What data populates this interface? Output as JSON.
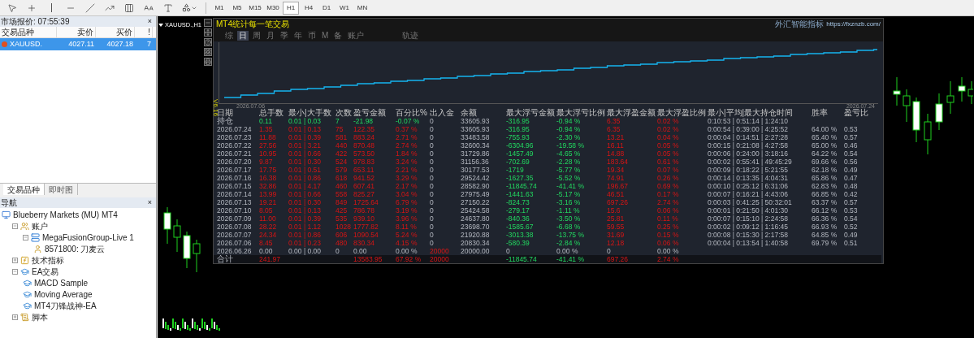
{
  "toolbar": {
    "timeframes": [
      {
        "label": "M1",
        "selected": false
      },
      {
        "label": "M5",
        "selected": false
      },
      {
        "label": "M15",
        "selected": false
      },
      {
        "label": "M30",
        "selected": false
      },
      {
        "label": "H1",
        "selected": true
      },
      {
        "label": "H4",
        "selected": false
      },
      {
        "label": "D1",
        "selected": false
      },
      {
        "label": "W1",
        "selected": false
      },
      {
        "label": "MN",
        "selected": false
      }
    ]
  },
  "market_watch": {
    "title": "市场报价: 07:55:39",
    "close": "×",
    "columns": [
      "交易品种",
      "卖价",
      "买价",
      "!"
    ],
    "rows": [
      {
        "cells": [
          "XAUUSD.",
          "4027.11",
          "4027.18",
          "7"
        ],
        "selected": true
      }
    ],
    "tabs": [
      {
        "label": "交易品种",
        "selected": true
      },
      {
        "label": "即时图",
        "selected": false
      }
    ]
  },
  "navigator": {
    "title": "导航",
    "close": "×",
    "tree": [
      {
        "label": "Blueberry Markets (MU) MT4",
        "kind": "terminal",
        "children": [
          {
            "label": "账户",
            "kind": "accounts",
            "expanded": true,
            "children": [
              {
                "label": "MegaFusionGroup-Live 1",
                "kind": "server",
                "expanded": true,
                "children": [
                  {
                    "label": "8571800: 刀麦云",
                    "kind": "account"
                  }
                ]
              }
            ]
          },
          {
            "label": "技术指标",
            "kind": "indicators",
            "expanded": false
          },
          {
            "label": "EA交易",
            "kind": "experts",
            "expanded": true,
            "children": [
              {
                "label": "MACD Sample",
                "kind": "expert"
              },
              {
                "label": "Moving Average",
                "kind": "expert"
              },
              {
                "label": "MT4刀锋战神-EA",
                "kind": "expert"
              }
            ]
          },
          {
            "label": "脚本",
            "kind": "scripts",
            "expanded": false
          }
        ]
      }
    ]
  },
  "chart": {
    "title": "XAUUSD.,H1",
    "panel": {
      "title": "MT4统计每一笔交易",
      "brand": "外汇智能指标",
      "link": "https://fxznzb.com/",
      "version": "V6.16",
      "tabs": [
        {
          "label": "综",
          "selected": false
        },
        {
          "label": "日",
          "selected": true
        },
        {
          "label": "周",
          "selected": false
        },
        {
          "label": "月",
          "selected": false
        },
        {
          "label": "季",
          "selected": false
        },
        {
          "label": "年",
          "selected": false
        },
        {
          "label": "币",
          "selected": false
        },
        {
          "label": "M",
          "selected": false
        },
        {
          "label": "备",
          "selected": false
        },
        {
          "label": "账户",
          "selected": false
        },
        {
          "label": "轨迹",
          "selected": false
        }
      ],
      "equity_dates": [
        "2026.07.06",
        "2026.07.24"
      ],
      "columns": [
        "日期",
        "总手数",
        "最小|大手数",
        "次数",
        "盈亏金额",
        "百分比%",
        "出入金",
        "余额",
        "最大浮亏金额",
        "最大浮亏比例",
        "最大浮盈金额",
        "最大浮盈比例",
        "最小|平均|最大持仓时间",
        "胜率",
        "盈亏比"
      ],
      "rows": [
        {
          "kind": "open",
          "cells": [
            "持仓",
            "0.11",
            "0.01 | 0.03",
            "7",
            "-21.98",
            "-0.07 %",
            "0",
            "33605.93",
            "-316.95",
            "-0.94 %",
            "6.35",
            "0.02 %",
            "0:10:53 | 0:51:14 | 1:24:10",
            null,
            null
          ]
        },
        {
          "kind": "day",
          "cells": [
            "2026.07.24",
            "1.35",
            "0.01 | 0.13",
            "75",
            "122.35",
            "0.37 %",
            "0",
            "33605.93",
            "-316.95",
            "-0.94 %",
            "6.35",
            "0.02 %",
            "0:00:54 | 0:39:00 | 4:25:52",
            "64.00 %",
            "0.53"
          ]
        },
        {
          "kind": "day",
          "cells": [
            "2026.07.23",
            "11.88",
            "0.01 | 0.39",
            "581",
            "883.24",
            "2.71 %",
            "0",
            "33483.58",
            "-755.93",
            "-2.30 %",
            "13.21",
            "0.04 %",
            "0:00:04 | 0:14:51 | 2:27:28",
            "65.40 %",
            "0.57"
          ]
        },
        {
          "kind": "day",
          "cells": [
            "2026.07.22",
            "27.56",
            "0.01 | 3.21",
            "440",
            "870.48",
            "2.74 %",
            "0",
            "32600.34",
            "-6304.96",
            "-19.58 %",
            "16.11",
            "0.05 %",
            "0:00:15 | 0:21:08 | 4:27:58",
            "65.00 %",
            "0.46"
          ]
        },
        {
          "kind": "day",
          "cells": [
            "2026.07.21",
            "10.95",
            "0.01 | 0.66",
            "422",
            "573.50",
            "1.84 %",
            "0",
            "31729.86",
            "-1457.49",
            "-4.65 %",
            "14.88",
            "0.05 %",
            "0:00:06 | 0:24:00 | 3:18:16",
            "64.22 %",
            "0.54"
          ]
        },
        {
          "kind": "day",
          "cells": [
            "2026.07.20",
            "9.87",
            "0.01 | 0.30",
            "524",
            "978.83",
            "3.24 %",
            "0",
            "31156.36",
            "-702.69",
            "-2.28 %",
            "183.64",
            "0.61 %",
            "0:00:02 | 0:55:41 | 49:45:29",
            "69.66 %",
            "0.56"
          ]
        },
        {
          "kind": "day",
          "cells": [
            "2026.07.17",
            "17.75",
            "0.01 | 0.51",
            "579",
            "653.11",
            "2.21 %",
            "0",
            "30177.53",
            "-1719",
            "-5.77 %",
            "19.34",
            "0.07 %",
            "0:00:09 | 0:18:22 | 5:21:55",
            "62.18 %",
            "0.49"
          ]
        },
        {
          "kind": "day",
          "cells": [
            "2026.07.16",
            "16.38",
            "0.01 | 0.86",
            "618",
            "941.52",
            "3.29 %",
            "0",
            "29524.42",
            "-1627.35",
            "-5.52 %",
            "74.91",
            "0.26 %",
            "0:00:14 | 0:13:35 | 4:04:31",
            "65.86 %",
            "0.47"
          ]
        },
        {
          "kind": "day",
          "cells": [
            "2026.07.15",
            "32.86",
            "0.01 | 4.17",
            "460",
            "607.41",
            "2.17 %",
            "0",
            "28582.90",
            "-11845.74",
            "-41.41 %",
            "196.67",
            "0.69 %",
            "0:00:10 | 0:25:12 | 6:31:06",
            "62.83 %",
            "0.48"
          ]
        },
        {
          "kind": "day",
          "cells": [
            "2026.07.14",
            "13.99",
            "0.01 | 0.66",
            "558",
            "825.27",
            "3.04 %",
            "0",
            "27975.49",
            "-1441.63",
            "-5.17 %",
            "46.51",
            "0.17 %",
            "0:00:07 | 0:16:21 | 4:43:06",
            "66.85 %",
            "0.42"
          ]
        },
        {
          "kind": "day",
          "cells": [
            "2026.07.13",
            "19.21",
            "0.01 | 0.30",
            "849",
            "1725.64",
            "6.79 %",
            "0",
            "27150.22",
            "-824.73",
            "-3.16 %",
            "697.26",
            "2.74 %",
            "0:00:03 | 0:41:25 | 50:32:01",
            "63.37 %",
            "0.57"
          ]
        },
        {
          "kind": "day",
          "cells": [
            "2026.07.10",
            "8.05",
            "0.01 | 0.13",
            "425",
            "786.78",
            "3.19 %",
            "0",
            "25424.58",
            "-279.17",
            "-1.11 %",
            "15.6",
            "0.06 %",
            "0:00:01 | 0:21:50 | 4:01:30",
            "66.12 %",
            "0.53"
          ]
        },
        {
          "kind": "day",
          "cells": [
            "2026.07.09",
            "11.00",
            "0.01 | 0.39",
            "535",
            "939.10",
            "3.96 %",
            "0",
            "24637.80",
            "-840.36",
            "-3.50 %",
            "25.81",
            "0.11 %",
            "0:00:07 | 0:15:10 | 2:24:58",
            "66.36 %",
            "0.54"
          ]
        },
        {
          "kind": "day",
          "cells": [
            "2026.07.08",
            "28.22",
            "0.01 | 1.12",
            "1028",
            "1777.82",
            "8.11 %",
            "0",
            "23698.70",
            "-1585.67",
            "-6.68 %",
            "59.55",
            "0.25 %",
            "0:00:02 | 0:09:12 | 1:16:45",
            "66.93 %",
            "0.52"
          ]
        },
        {
          "kind": "day",
          "cells": [
            "2026.07.07",
            "24.34",
            "0.01 | 0.86",
            "606",
            "1090.54",
            "5.24 %",
            "0",
            "21920.88",
            "-3013.38",
            "-13.75 %",
            "31.69",
            "0.15 %",
            "0:00:08 | 0:15:30 | 2:17:58",
            "64.85 %",
            "0.49"
          ]
        },
        {
          "kind": "day",
          "cells": [
            "2026.07.06",
            "8.45",
            "0.01 | 0.23",
            "480",
            "830.34",
            "4.15 %",
            "0",
            "20830.34",
            "-580.39",
            "-2.84 %",
            "12.18",
            "0.06 %",
            "0:00:04 | 0:13:54 | 1:40:58",
            "69.79 %",
            "0.51"
          ]
        },
        {
          "kind": "deposit",
          "cells": [
            "2026.06.26",
            "0.00",
            "0.00 | 0.00",
            "0",
            "0.00",
            "0.00 %",
            "20000",
            "20000.00",
            "0",
            "0.00 %",
            "0",
            "0.00 %",
            null,
            null,
            null
          ]
        },
        {
          "kind": "total",
          "cells": [
            "合计",
            "241.97",
            null,
            null,
            "13583.95",
            "67.92 %",
            "20000",
            null,
            "-11845.74",
            "-41.41 %",
            "697.26",
            "2.74 %",
            null,
            null,
            null
          ]
        }
      ]
    }
  }
}
